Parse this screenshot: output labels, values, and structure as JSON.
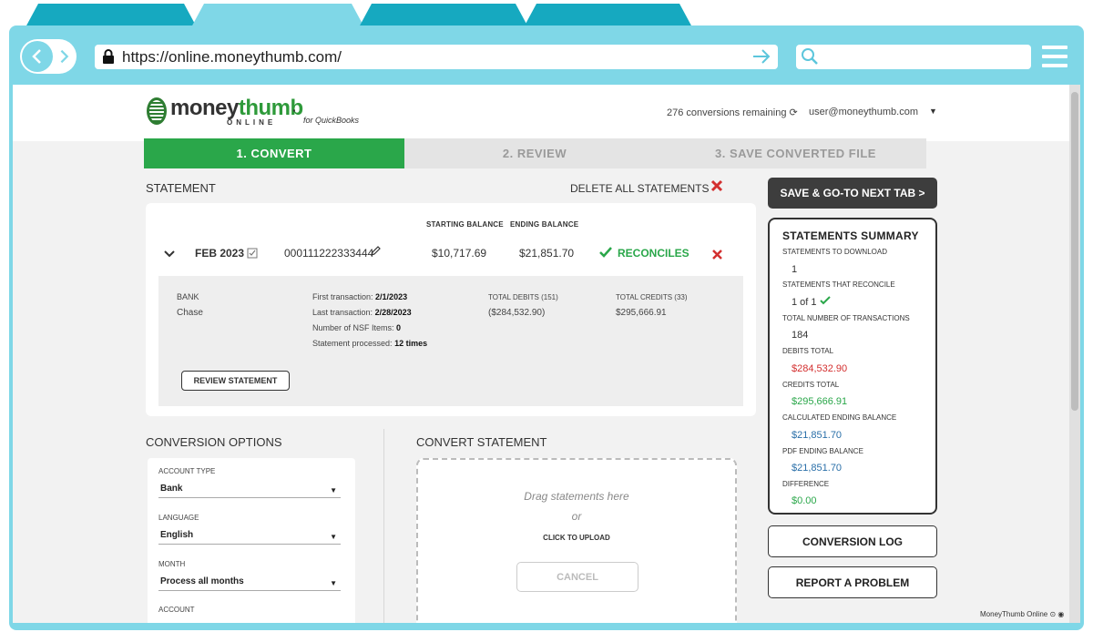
{
  "browser": {
    "url": "https://online.moneythumb.com/",
    "colors": {
      "tab": "#16a9c0",
      "chrome": "#7fd7e7"
    }
  },
  "header": {
    "logo_text_a": "money",
    "logo_text_b": "thumb",
    "logo_online": "ONLINE",
    "logo_for": "for QuickBooks",
    "conversions_remaining": "276 conversions remaining",
    "user_email": "user@moneythumb.com"
  },
  "steps": [
    {
      "label": "1. CONVERT"
    },
    {
      "label": "2. REVIEW"
    },
    {
      "label": "3. SAVE CONVERTED FILE"
    }
  ],
  "statement_section": {
    "title": "STATEMENT",
    "delete_all": "DELETE ALL STATEMENTS",
    "col_starting": "STARTING BALANCE",
    "col_ending": "ENDING BALANCE",
    "row": {
      "month": "FEB 2023",
      "account": "000111222333444",
      "starting_balance": "$10,717.69",
      "ending_balance": "$21,851.70",
      "status": "RECONCILES"
    },
    "details": {
      "bank_label": "BANK",
      "bank_value": "Chase",
      "first_tx_label": "First transaction:",
      "first_tx_value": "2/1/2023",
      "last_tx_label": "Last transaction:",
      "last_tx_value": "2/28/2023",
      "nsf_label": "Number of NSF Items:",
      "nsf_value": "0",
      "processed_label": "Statement processed:",
      "processed_value": "12 times",
      "total_debits_label": "TOTAL DEBITS (151)",
      "total_debits_value": "($284,532.90)",
      "total_credits_label": "TOTAL CREDITS (33)",
      "total_credits_value": "$295,666.91"
    },
    "review_button": "REVIEW STATEMENT"
  },
  "save_button": "SAVE & GO-TO NEXT TAB >",
  "summary": {
    "title": "STATEMENTS SUMMARY",
    "items": [
      {
        "label": "STATEMENTS TO DOWNLOAD",
        "value": "1"
      },
      {
        "label": "STATEMENTS THAT RECONCILE",
        "value": "1 of 1"
      },
      {
        "label": "TOTAL NUMBER OF TRANSACTIONS",
        "value": "184"
      },
      {
        "label": "DEBITS TOTAL",
        "value": "$284,532.90"
      },
      {
        "label": "CREDITS TOTAL",
        "value": "$295,666.91"
      },
      {
        "label": "CALCULATED ENDING BALANCE",
        "value": "$21,851.70"
      },
      {
        "label": "PDF ENDING BALANCE",
        "value": "$21,851.70"
      },
      {
        "label": "DIFFERENCE",
        "value": "$0.00"
      }
    ]
  },
  "conversion_log_button": "CONVERSION LOG",
  "report_problem_button": "REPORT A PROBLEM",
  "conversion_options": {
    "title": "CONVERSION OPTIONS",
    "account_type_label": "ACCOUNT TYPE",
    "account_type_value": "Bank",
    "language_label": "LANGUAGE",
    "language_value": "English",
    "month_label": "MONTH",
    "month_value": "Process all months",
    "account_label": "ACCOUNT"
  },
  "convert_statement": {
    "title": "CONVERT STATEMENT",
    "drag_text": "Drag statements here",
    "or_text": "or",
    "click_upload": "CLICK TO UPLOAD",
    "cancel": "CANCEL"
  },
  "footer": "MoneyThumb Online"
}
